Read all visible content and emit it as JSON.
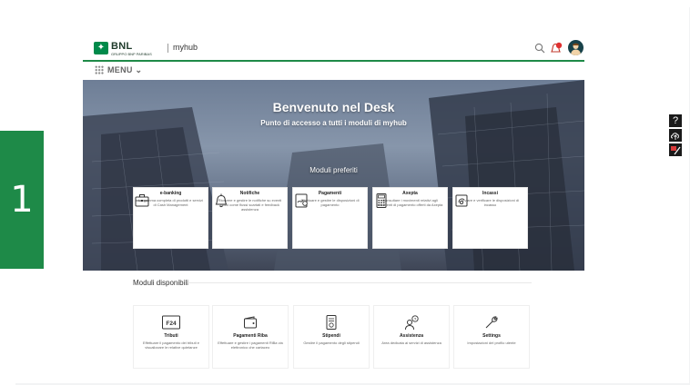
{
  "slide": {
    "number": "1"
  },
  "header": {
    "brand": "BNL",
    "brand_sub": "GRUPPO BNP PARIBAS",
    "app_name": "myhub"
  },
  "menu": {
    "label": "MENU"
  },
  "hero": {
    "title": "Benvenuto nel Desk",
    "subtitle": "Punto di accesso a tutti i moduli di myhub",
    "favorites_title": "Moduli preferiti"
  },
  "favorites": [
    {
      "name": "e-banking",
      "desc": "La gamma completa di prodotti e servizi di Cash Management",
      "icon": "briefcase-icon"
    },
    {
      "name": "Notifiche",
      "desc": "Ricevere e gestire le notifiche su eventi critici come flussi scartati e feedback assistenza",
      "icon": "bell-icon"
    },
    {
      "name": "Pagamenti",
      "desc": "Effettuare e gestire le disposizioni di pagamento",
      "icon": "payment-icon"
    },
    {
      "name": "Axepta",
      "desc": "Consultare i movimenti relativi agli strumenti di pagamento offerti da Axepta",
      "icon": "calculator-icon"
    },
    {
      "name": "Incassi",
      "desc": "Inviare e verificare le disposizioni di incasso",
      "icon": "collection-icon"
    }
  ],
  "modules": {
    "title": "Moduli disponibili",
    "items": [
      {
        "name": "Tributi",
        "desc": "Effettuare il pagamento dei tributi e visualizzare le relative quietanze",
        "icon": "f24-icon",
        "icon_text": "F24"
      },
      {
        "name": "Pagamenti Riba",
        "desc": "Effettuare e gestire i pagamenti RiBa via elettronico che cartaceo",
        "icon": "wallet-icon"
      },
      {
        "name": "Stipendi",
        "desc": "Gestire il pagamento degli stipendi",
        "icon": "payslip-icon"
      },
      {
        "name": "Assistenza",
        "desc": "Area dedicata ai servizi di assistenza",
        "icon": "support-icon"
      },
      {
        "name": "Settings",
        "desc": "Impostazioni del profilo utente",
        "icon": "wrench-icon"
      }
    ]
  },
  "side_toolbar": {
    "help_glyph": "?",
    "items": [
      "help-icon",
      "cloud-upload-icon",
      "annotate-icon"
    ]
  },
  "colors": {
    "brand_green": "#1e8a48",
    "logo_green": "#008a4a",
    "notification_red": "#e03030",
    "avatar": "#18424a"
  }
}
